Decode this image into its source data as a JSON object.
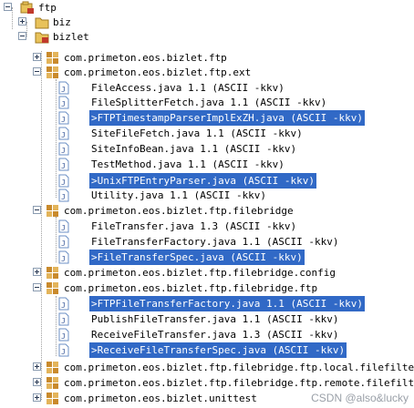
{
  "tree": {
    "root": "ftp",
    "biz": "biz",
    "bizlet": "bizlet",
    "pkg_ftp": "com.primeton.eos.bizlet.ftp",
    "pkg_ext": "com.primeton.eos.bizlet.ftp.ext",
    "ext_files": [
      {
        "label": "FileAccess.java  1.1  (ASCII -kkv)"
      },
      {
        "label": "FileSplitterFetch.java  1.1  (ASCII -kkv)"
      },
      {
        "label": ">FTPTimestampParserImplExZH.java    (ASCII -kkv)"
      },
      {
        "label": "SiteFileFetch.java  1.1  (ASCII -kkv)"
      },
      {
        "label": "SiteInfoBean.java  1.1  (ASCII -kkv)"
      },
      {
        "label": "TestMethod.java  1.1  (ASCII -kkv)"
      },
      {
        "label": ">UnixFTPEntryParser.java    (ASCII -kkv)"
      },
      {
        "label": "Utility.java  1.1  (ASCII -kkv)"
      }
    ],
    "pkg_filebridge": "com.primeton.eos.bizlet.ftp.filebridge",
    "filebridge_files": [
      {
        "label": "FileTransfer.java  1.3  (ASCII -kkv)"
      },
      {
        "label": "FileTransferFactory.java  1.1  (ASCII -kkv)"
      },
      {
        "label": ">FileTransferSpec.java    (ASCII -kkv)"
      }
    ],
    "pkg_fb_config": "com.primeton.eos.bizlet.ftp.filebridge.config",
    "pkg_fb_ftp": "com.primeton.eos.bizlet.ftp.filebridge.ftp",
    "fb_ftp_files": [
      {
        "label": ">FTPFileTransferFactory.java  1.1  (ASCII -kkv)"
      },
      {
        "label": "PublishFileTransfer.java  1.1  (ASCII -kkv)"
      },
      {
        "label": "ReceiveFileTransfer.java  1.3  (ASCII -kkv)"
      },
      {
        "label": ">ReceiveFileTransferSpec.java    (ASCII -kkv)"
      }
    ],
    "pkg_fb_ftp_local": "com.primeton.eos.bizlet.ftp.filebridge.ftp.local.filefilter",
    "pkg_fb_ftp_remote": "com.primeton.eos.bizlet.ftp.filebridge.ftp.remote.filefilter",
    "pkg_unittest": "com.primeton.eos.bizlet.unittest"
  },
  "watermark": "CSDN @also&lucky",
  "colors": {
    "selection": "#3169c6",
    "package": "#c98a2c",
    "folder": "#e8c25a",
    "java_file": "#6b8fc4"
  }
}
